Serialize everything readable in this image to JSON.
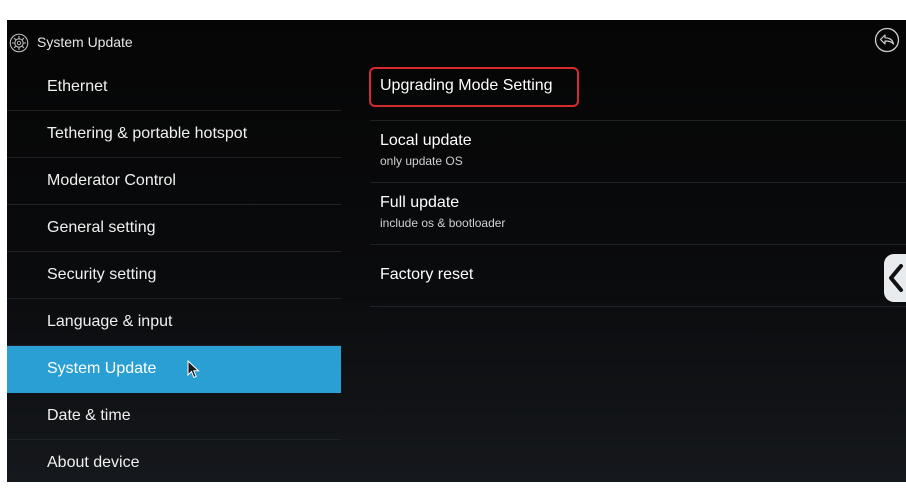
{
  "header": {
    "title": "System Update",
    "icons": {
      "settings": "gear-icon",
      "back": "back-arrow-icon"
    }
  },
  "sidebar": {
    "items": [
      {
        "label": "Ethernet",
        "selected": false
      },
      {
        "label": "Tethering & portable hotspot",
        "selected": false
      },
      {
        "label": "Moderator Control",
        "selected": false
      },
      {
        "label": "General setting",
        "selected": false
      },
      {
        "label": "Security setting",
        "selected": false
      },
      {
        "label": "Language & input",
        "selected": false
      },
      {
        "label": "System Update",
        "selected": true
      },
      {
        "label": "Date & time",
        "selected": false
      },
      {
        "label": "About device",
        "selected": false
      }
    ]
  },
  "main": {
    "options": [
      {
        "title": "Upgrading Mode Setting",
        "subtitle": "",
        "highlighted": true
      },
      {
        "title": "Local update",
        "subtitle": "only update OS"
      },
      {
        "title": "Full update",
        "subtitle": "include os & bootloader"
      },
      {
        "title": "Factory reset",
        "subtitle": ""
      }
    ]
  },
  "colors": {
    "selection": "#2a9fd4",
    "highlight_border": "#d62b2b",
    "background": "#050505",
    "text": "#ffffff"
  },
  "edge_tab_icon": "chevron-left-icon"
}
